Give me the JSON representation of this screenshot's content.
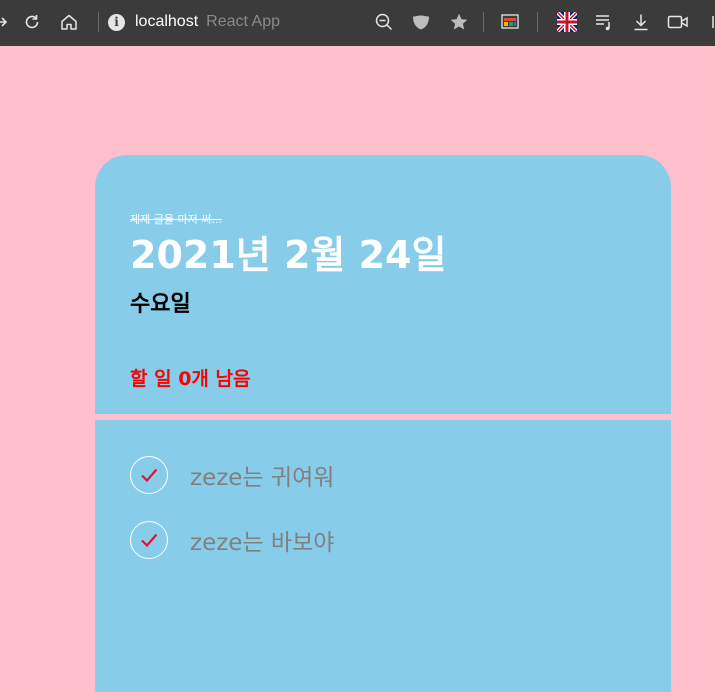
{
  "browser": {
    "host": "localhost",
    "page_title": "React App"
  },
  "header": {
    "note": "제제 글을 마저 써...",
    "date": "2021년 2월 24일",
    "weekday": "수요일",
    "remaining": "할 일 0개 남음"
  },
  "todos": [
    {
      "text": "zeze는 귀여워",
      "done": true
    },
    {
      "text": "zeze는 바보야",
      "done": true
    }
  ],
  "colors": {
    "background": "#ffc0cb",
    "card": "#87cdea",
    "accent": "#ff0000",
    "check": "#e8112d"
  }
}
